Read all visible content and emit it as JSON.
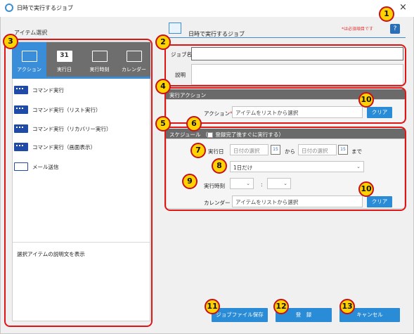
{
  "window": {
    "title": "日時で実行するジョブ",
    "close_symbol": "×"
  },
  "left": {
    "heading": "アイテム選択",
    "tabs": [
      {
        "label": "アクション",
        "icon": "action-icon",
        "active": true
      },
      {
        "label": "実行日",
        "icon": "calendar-31-icon",
        "icon_text": "31"
      },
      {
        "label": "実行時刻",
        "icon": "clock-icon"
      },
      {
        "label": "カレンダー",
        "icon": "calendar-grid-icon"
      }
    ],
    "items": [
      {
        "label": "コマンド実行",
        "icon": "command-icon"
      },
      {
        "label": "コマンド実行（リスト実行）",
        "icon": "command-list-icon"
      },
      {
        "label": "コマンド実行（リカバリー実行）",
        "icon": "command-recovery-icon"
      },
      {
        "label": "コマンド実行（画面表示）",
        "icon": "command-screen-icon"
      },
      {
        "label": "メール送信",
        "icon": "mail-icon"
      }
    ],
    "description": "選択アイテムの説明文を表示"
  },
  "right": {
    "title": "日時で実行するジョブ",
    "required_note": "*は必須項目です",
    "help_label": "?",
    "job_name_label": "ジョブ名",
    "required_mark": "*",
    "job_name_value": "",
    "description_label": "説明",
    "description_value": "",
    "action_section": {
      "header": "実行アクション",
      "action_label": "アクション",
      "action_value": "アイテムをリストから選択",
      "clear_label": "クリア"
    },
    "schedule_section": {
      "header": "スケジュール",
      "immediate_label": "登録完了後すぐに実行する",
      "paren_open": "（",
      "paren_close": "）",
      "date_label": "実行日",
      "date_from_placeholder": "日付の選択",
      "from_text": "から",
      "date_to_placeholder": "日付の選択",
      "until_text": "まで",
      "cal_icon_text": "15",
      "frequency_value": "1日だけ",
      "time_label": "実行時刻",
      "time_separator": ":",
      "calendar_label": "カレンダー",
      "calendar_value": "アイテムをリストから選択",
      "clear_label": "クリア"
    }
  },
  "buttons": {
    "save_file": "ジョブファイル保存",
    "register": "登　録",
    "cancel": "キャンセル"
  },
  "callouts": [
    "1",
    "2",
    "3",
    "4",
    "5",
    "6",
    "7",
    "8",
    "9",
    "10",
    "10",
    "11",
    "12",
    "13"
  ],
  "colors": {
    "accent": "#2a8bd6",
    "callout_red": "#e01616",
    "callout_fill": "#ffd200",
    "tab_bar": "#6e6e6e"
  }
}
